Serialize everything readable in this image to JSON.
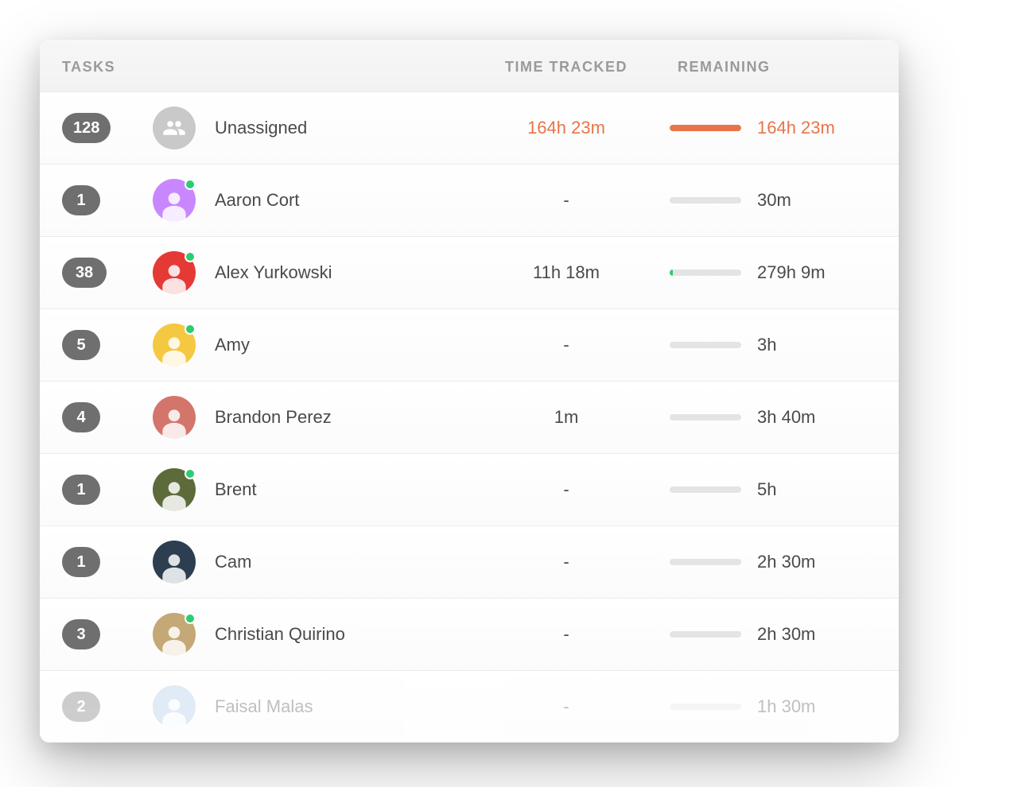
{
  "headers": {
    "tasks": "TASKS",
    "time_tracked": "TIME TRACKED",
    "remaining": "REMAINING"
  },
  "colors": {
    "accent": "#e8754a",
    "badge": "#6f6f6f",
    "online": "#2ecc71"
  },
  "rows": [
    {
      "tasks": "128",
      "name": "Unassigned",
      "avatar_type": "group",
      "avatar_color": "group",
      "online": false,
      "tracked": "164h 23m",
      "tracked_highlight": true,
      "remaining": "164h 23m",
      "remaining_highlight": true,
      "progress_pct": 100,
      "progress_color": "orange",
      "faded": false
    },
    {
      "tasks": "1",
      "name": "Aaron Cort",
      "avatar_type": "person",
      "avatar_color": "purple",
      "online": true,
      "tracked": "-",
      "tracked_highlight": false,
      "remaining": "30m",
      "remaining_highlight": false,
      "progress_pct": 0,
      "progress_color": "none",
      "faded": false
    },
    {
      "tasks": "38",
      "name": "Alex Yurkowski",
      "avatar_type": "person",
      "avatar_color": "red",
      "online": true,
      "tracked": "11h 18m",
      "tracked_highlight": false,
      "remaining": "279h 9m",
      "remaining_highlight": false,
      "progress_pct": 4,
      "progress_color": "green",
      "faded": false
    },
    {
      "tasks": "5",
      "name": "Amy",
      "avatar_type": "person",
      "avatar_color": "yellow",
      "online": true,
      "tracked": "-",
      "tracked_highlight": false,
      "remaining": "3h",
      "remaining_highlight": false,
      "progress_pct": 0,
      "progress_color": "none",
      "faded": false
    },
    {
      "tasks": "4",
      "name": "Brandon Perez",
      "avatar_type": "person",
      "avatar_color": "coral",
      "online": false,
      "tracked": "1m",
      "tracked_highlight": false,
      "remaining": "3h 40m",
      "remaining_highlight": false,
      "progress_pct": 0,
      "progress_color": "none",
      "faded": false
    },
    {
      "tasks": "1",
      "name": "Brent",
      "avatar_type": "person",
      "avatar_color": "olive",
      "online": true,
      "tracked": "-",
      "tracked_highlight": false,
      "remaining": "5h",
      "remaining_highlight": false,
      "progress_pct": 0,
      "progress_color": "none",
      "faded": false
    },
    {
      "tasks": "1",
      "name": "Cam",
      "avatar_type": "person",
      "avatar_color": "navy",
      "online": false,
      "tracked": "-",
      "tracked_highlight": false,
      "remaining": "2h 30m",
      "remaining_highlight": false,
      "progress_pct": 0,
      "progress_color": "none",
      "faded": false
    },
    {
      "tasks": "3",
      "name": "Christian Quirino",
      "avatar_type": "person",
      "avatar_color": "tan",
      "online": true,
      "tracked": "-",
      "tracked_highlight": false,
      "remaining": "2h 30m",
      "remaining_highlight": false,
      "progress_pct": 0,
      "progress_color": "none",
      "faded": false
    },
    {
      "tasks": "2",
      "name": "Faisal Malas",
      "avatar_type": "person",
      "avatar_color": "sky",
      "online": false,
      "tracked": "-",
      "tracked_highlight": false,
      "remaining": "1h 30m",
      "remaining_highlight": false,
      "progress_pct": 0,
      "progress_color": "none",
      "faded": true
    }
  ]
}
